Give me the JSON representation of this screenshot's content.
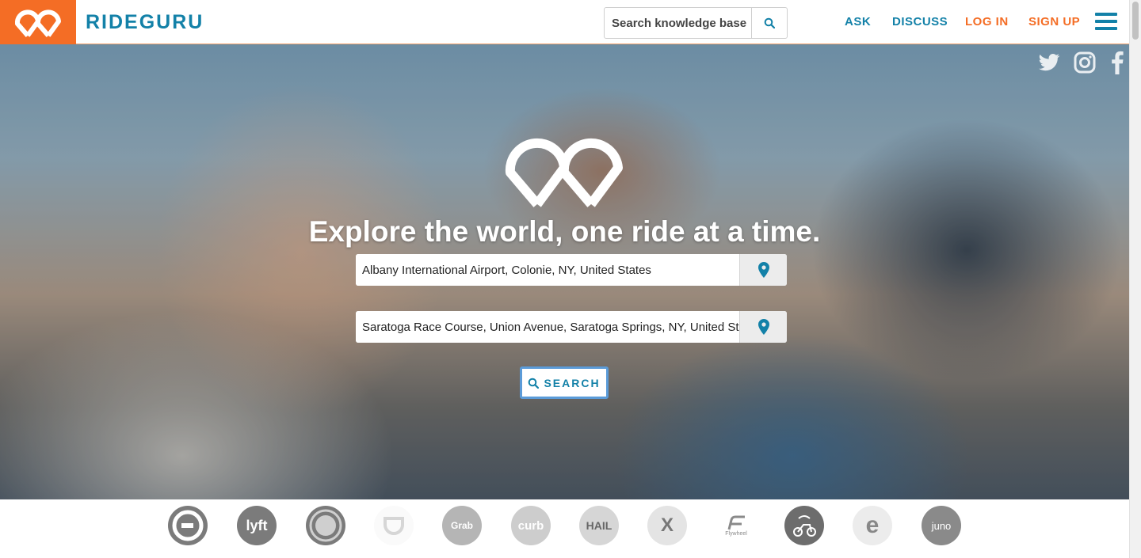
{
  "header": {
    "brand": "RIDEGURU",
    "kb_search_placeholder": "Search knowledge base",
    "nav": {
      "ask": "ASK",
      "discuss": "DISCUSS",
      "login": "LOG IN",
      "signup": "SIGN UP"
    }
  },
  "hero": {
    "tagline": "Explore the world, one ride at a time.",
    "from_value": "Albany International Airport, Colonie, NY, United States",
    "to_value": "Saratoga Race Course, Union Avenue, Saratoga Springs, NY, United States",
    "search_label": "SEARCH",
    "social": [
      "twitter-icon",
      "instagram-icon",
      "facebook-icon"
    ]
  },
  "providers": [
    {
      "name": "uber",
      "label": ""
    },
    {
      "name": "lyft",
      "label": "lyft"
    },
    {
      "name": "circle",
      "label": ""
    },
    {
      "name": "didi",
      "label": ""
    },
    {
      "name": "grab",
      "label": "Grab"
    },
    {
      "name": "curb",
      "label": "curb"
    },
    {
      "name": "hail",
      "label": "HAIL"
    },
    {
      "name": "x",
      "label": "X"
    },
    {
      "name": "flywheel",
      "label": "Flywheel"
    },
    {
      "name": "moto",
      "label": ""
    },
    {
      "name": "e",
      "label": "e"
    },
    {
      "name": "juno",
      "label": "juno"
    }
  ],
  "colors": {
    "brand_blue": "#1381a8",
    "brand_orange": "#f46d25"
  }
}
